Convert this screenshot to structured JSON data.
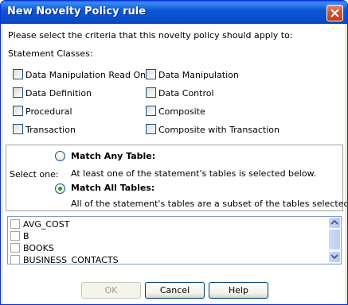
{
  "window": {
    "title": "New Novelty Policy rule"
  },
  "prompt": "Please select the criteria that this novelty policy should apply to:",
  "statement_classes": {
    "label": "Statement Classes:",
    "items": [
      {
        "label": "Data Manipulation Read Only",
        "checked": false
      },
      {
        "label": "Data Manipulation",
        "checked": false
      },
      {
        "label": "Data Definition",
        "checked": false
      },
      {
        "label": "Data Control",
        "checked": false
      },
      {
        "label": "Procedural",
        "checked": false
      },
      {
        "label": "Composite",
        "checked": false
      },
      {
        "label": "Transaction",
        "checked": false
      },
      {
        "label": "Composite with Transaction",
        "checked": false
      }
    ]
  },
  "match": {
    "select_label": "Select one:",
    "any": {
      "label": "Match Any Table:",
      "description": "At least one of the statement's tables is selected below.",
      "selected": false
    },
    "all": {
      "label": "Match All Tables:",
      "description": "All of the statement's tables are a subset of the tables selected below.",
      "selected": true
    }
  },
  "tables": {
    "rows": [
      "AVG_COST",
      "B",
      "BOOKS",
      "BUSINESS_CONTACTS"
    ]
  },
  "buttons": {
    "ok": "OK",
    "cancel": "Cancel",
    "help": "Help"
  },
  "colors": {
    "title_bar": "#0a4bc6",
    "dialog_bg": "#ece9d8",
    "radio_dot": "#21a121"
  }
}
